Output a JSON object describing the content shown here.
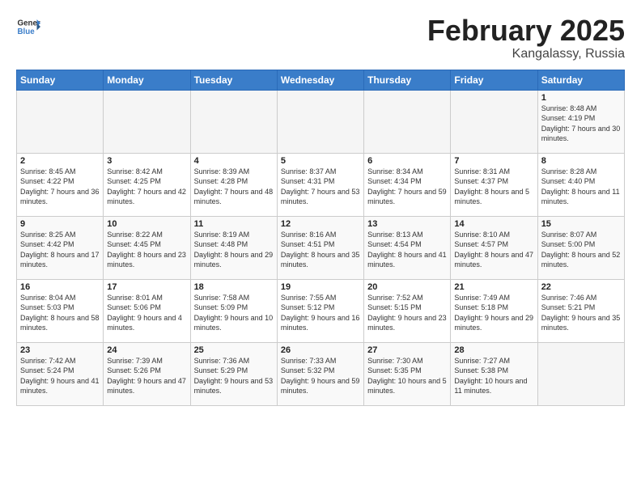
{
  "header": {
    "logo_general": "General",
    "logo_blue": "Blue",
    "month_title": "February 2025",
    "subtitle": "Kangalassy, Russia"
  },
  "weekdays": [
    "Sunday",
    "Monday",
    "Tuesday",
    "Wednesday",
    "Thursday",
    "Friday",
    "Saturday"
  ],
  "weeks": [
    [
      {
        "day": "",
        "info": ""
      },
      {
        "day": "",
        "info": ""
      },
      {
        "day": "",
        "info": ""
      },
      {
        "day": "",
        "info": ""
      },
      {
        "day": "",
        "info": ""
      },
      {
        "day": "",
        "info": ""
      },
      {
        "day": "1",
        "info": "Sunrise: 8:48 AM\nSunset: 4:19 PM\nDaylight: 7 hours and 30 minutes."
      }
    ],
    [
      {
        "day": "2",
        "info": "Sunrise: 8:45 AM\nSunset: 4:22 PM\nDaylight: 7 hours and 36 minutes."
      },
      {
        "day": "3",
        "info": "Sunrise: 8:42 AM\nSunset: 4:25 PM\nDaylight: 7 hours and 42 minutes."
      },
      {
        "day": "4",
        "info": "Sunrise: 8:39 AM\nSunset: 4:28 PM\nDaylight: 7 hours and 48 minutes."
      },
      {
        "day": "5",
        "info": "Sunrise: 8:37 AM\nSunset: 4:31 PM\nDaylight: 7 hours and 53 minutes."
      },
      {
        "day": "6",
        "info": "Sunrise: 8:34 AM\nSunset: 4:34 PM\nDaylight: 7 hours and 59 minutes."
      },
      {
        "day": "7",
        "info": "Sunrise: 8:31 AM\nSunset: 4:37 PM\nDaylight: 8 hours and 5 minutes."
      },
      {
        "day": "8",
        "info": "Sunrise: 8:28 AM\nSunset: 4:40 PM\nDaylight: 8 hours and 11 minutes."
      }
    ],
    [
      {
        "day": "9",
        "info": "Sunrise: 8:25 AM\nSunset: 4:42 PM\nDaylight: 8 hours and 17 minutes."
      },
      {
        "day": "10",
        "info": "Sunrise: 8:22 AM\nSunset: 4:45 PM\nDaylight: 8 hours and 23 minutes."
      },
      {
        "day": "11",
        "info": "Sunrise: 8:19 AM\nSunset: 4:48 PM\nDaylight: 8 hours and 29 minutes."
      },
      {
        "day": "12",
        "info": "Sunrise: 8:16 AM\nSunset: 4:51 PM\nDaylight: 8 hours and 35 minutes."
      },
      {
        "day": "13",
        "info": "Sunrise: 8:13 AM\nSunset: 4:54 PM\nDaylight: 8 hours and 41 minutes."
      },
      {
        "day": "14",
        "info": "Sunrise: 8:10 AM\nSunset: 4:57 PM\nDaylight: 8 hours and 47 minutes."
      },
      {
        "day": "15",
        "info": "Sunrise: 8:07 AM\nSunset: 5:00 PM\nDaylight: 8 hours and 52 minutes."
      }
    ],
    [
      {
        "day": "16",
        "info": "Sunrise: 8:04 AM\nSunset: 5:03 PM\nDaylight: 8 hours and 58 minutes."
      },
      {
        "day": "17",
        "info": "Sunrise: 8:01 AM\nSunset: 5:06 PM\nDaylight: 9 hours and 4 minutes."
      },
      {
        "day": "18",
        "info": "Sunrise: 7:58 AM\nSunset: 5:09 PM\nDaylight: 9 hours and 10 minutes."
      },
      {
        "day": "19",
        "info": "Sunrise: 7:55 AM\nSunset: 5:12 PM\nDaylight: 9 hours and 16 minutes."
      },
      {
        "day": "20",
        "info": "Sunrise: 7:52 AM\nSunset: 5:15 PM\nDaylight: 9 hours and 23 minutes."
      },
      {
        "day": "21",
        "info": "Sunrise: 7:49 AM\nSunset: 5:18 PM\nDaylight: 9 hours and 29 minutes."
      },
      {
        "day": "22",
        "info": "Sunrise: 7:46 AM\nSunset: 5:21 PM\nDaylight: 9 hours and 35 minutes."
      }
    ],
    [
      {
        "day": "23",
        "info": "Sunrise: 7:42 AM\nSunset: 5:24 PM\nDaylight: 9 hours and 41 minutes."
      },
      {
        "day": "24",
        "info": "Sunrise: 7:39 AM\nSunset: 5:26 PM\nDaylight: 9 hours and 47 minutes."
      },
      {
        "day": "25",
        "info": "Sunrise: 7:36 AM\nSunset: 5:29 PM\nDaylight: 9 hours and 53 minutes."
      },
      {
        "day": "26",
        "info": "Sunrise: 7:33 AM\nSunset: 5:32 PM\nDaylight: 9 hours and 59 minutes."
      },
      {
        "day": "27",
        "info": "Sunrise: 7:30 AM\nSunset: 5:35 PM\nDaylight: 10 hours and 5 minutes."
      },
      {
        "day": "28",
        "info": "Sunrise: 7:27 AM\nSunset: 5:38 PM\nDaylight: 10 hours and 11 minutes."
      },
      {
        "day": "",
        "info": ""
      }
    ]
  ]
}
